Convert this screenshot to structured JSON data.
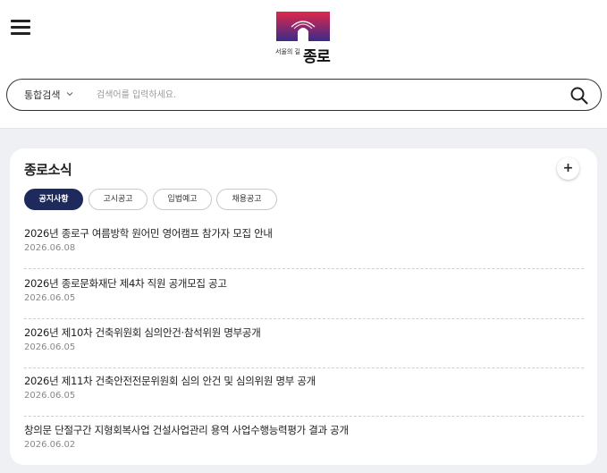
{
  "header": {
    "menu_icon": "hamburger-menu-icon",
    "logo": {
      "small_text": "서울의 길",
      "big_text": "종로",
      "icon": "jongno-gate-logo-icon"
    }
  },
  "search": {
    "scope_label": "통합검색",
    "scope_icon": "chevron-down-icon",
    "placeholder": "검색어를 입력하세요.",
    "value": "",
    "button_icon": "search-icon"
  },
  "news": {
    "title": "종로소식",
    "more_label": "+",
    "tabs": [
      {
        "label": "공지사항",
        "active": true
      },
      {
        "label": "고시공고",
        "active": false
      },
      {
        "label": "입법예고",
        "active": false
      },
      {
        "label": "채용공고",
        "active": false
      }
    ],
    "items": [
      {
        "title": "2026년 종로구 여름방학 원어민 영어캠프 참가자 모집 안내",
        "date": "2026.06.08"
      },
      {
        "title": "2026년 종로문화재단 제4차 직원 공개모집 공고",
        "date": "2026.06.05"
      },
      {
        "title": "2026년 제10차 건축위원회 심의안건·참석위원 명부공개",
        "date": "2026.06.05"
      },
      {
        "title": "2026년 제11차 건축안전전문위원회 심의 안건 및 심의위원 명부 공개",
        "date": "2026.06.05"
      },
      {
        "title": "창의문 단절구간 지형회복사업 건설사업관리 용역 사업수행능력평가 결과 공개",
        "date": "2026.06.02"
      }
    ]
  },
  "colors": {
    "accent_navy": "#1f2a5c",
    "page_bg": "#eef0f4",
    "logo_top": "#e0284a",
    "logo_bottom": "#3b2a8a"
  }
}
